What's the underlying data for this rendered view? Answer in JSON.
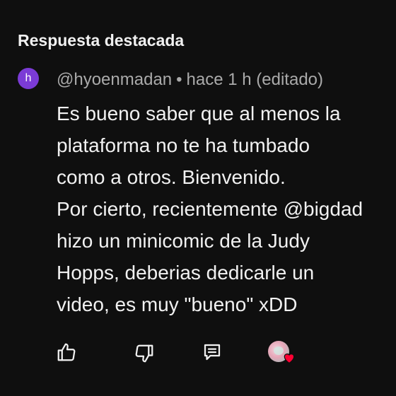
{
  "section": {
    "title": "Respuesta destacada"
  },
  "comment": {
    "avatar_letter": "h",
    "author": "@hyoenmadan",
    "separator": "•",
    "time": "hace 1 h (editado)",
    "lines": [
      "Es bueno saber que al menos la",
      "plataforma no te ha tumbado",
      "como a otros. Bienvenido.",
      "Por cierto, recientemente @bigdad",
      "hizo un minicomic de la Judy",
      "Hopps, deberias dedicarle un",
      "video, es muy \"bueno\" xDD"
    ]
  },
  "actions": {
    "icons": [
      "thumb-up-icon",
      "thumb-down-icon",
      "reply-icon",
      "creator-heart-icon"
    ]
  },
  "colors": {
    "background": "#0f0f0f",
    "text": "#f1f1f1",
    "meta": "#aaaaaa",
    "avatar": "#7b3bd6",
    "heart": "#ff0033"
  }
}
